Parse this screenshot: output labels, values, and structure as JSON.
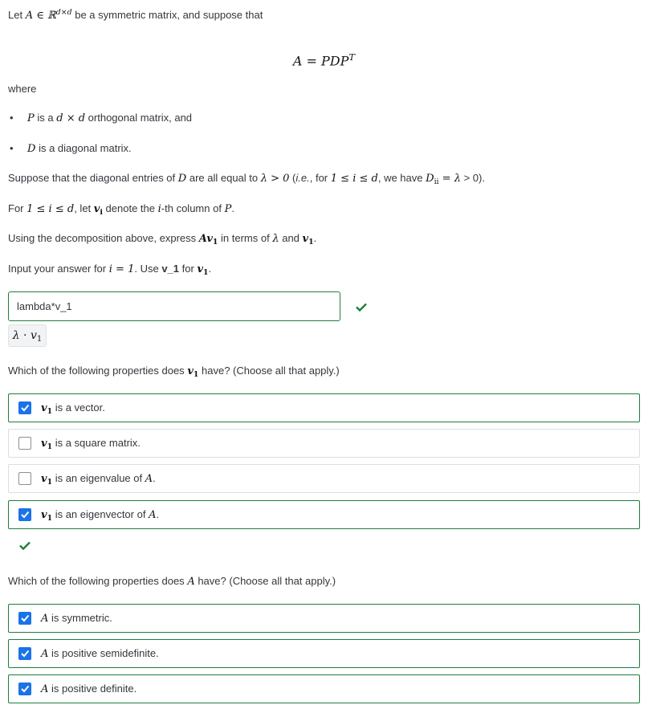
{
  "intro": {
    "prefix": "Let",
    "math_setA": "A ∈ ℝ",
    "math_setsup": "d×d",
    "suffix": "be a symmetric matrix, and suppose that"
  },
  "equation": {
    "lhs": "A = PDP",
    "sup": "T"
  },
  "where_label": "where",
  "bullets": [
    {
      "math": "P",
      "text_pre": "is a",
      "math2": "d × d",
      "text_post": "orthogonal matrix, and"
    },
    {
      "math": "D",
      "text_post": "is a diagonal matrix."
    }
  ],
  "suppose": {
    "t1": "Suppose that the diagonal entries of",
    "m1": "D",
    "t2": "are all equal to",
    "m2": "λ > 0",
    "t3": "(",
    "t3_italic": "i.e.",
    "t3b": ", for",
    "m3": "1 ≤ i ≤ d",
    "t4": ", we have",
    "m4": "D",
    "m4_sub": "ii",
    "m4_rest": " = λ",
    "t5": "> 0)."
  },
  "for_line": {
    "t1": "For",
    "m1": "1 ≤ i ≤ d",
    "t2": ", let",
    "m2": "v",
    "m2_sub": "i",
    "t3": "denote the",
    "m3": "i",
    "t4": "-th column of",
    "m4": "P",
    "t5": "."
  },
  "using_line": {
    "t1": "Using the decomposition above, express",
    "m1": "Av",
    "m1_sub": "1",
    "t2": "in terms of",
    "m2": "λ",
    "t3": "and",
    "m3": "v",
    "m3_sub": "1",
    "t4": "."
  },
  "input_line": {
    "t1": "Input your answer for",
    "m1": "i = 1",
    "t2": ". Use",
    "code": "v_1",
    "t3": "for",
    "m2": "v",
    "m2_sub": "1",
    "t4": "."
  },
  "answer": {
    "value": "lambda*v_1",
    "preview_lambda": "λ · v",
    "preview_sub": "1"
  },
  "q1": {
    "t1": "Which of the following properties does",
    "m1": "v",
    "m1_sub": "1",
    "t2": "have? (Choose all that apply.)",
    "options": [
      {
        "m": "v",
        "sub": "1",
        "text": "is a vector.",
        "checked": true
      },
      {
        "m": "v",
        "sub": "1",
        "text": "is a square matrix.",
        "checked": false
      },
      {
        "m": "v",
        "sub": "1",
        "text": "is an eigenvalue of",
        "m2": "A",
        "end": ".",
        "checked": false
      },
      {
        "m": "v",
        "sub": "1",
        "text": "is an eigenvector of",
        "m2": "A",
        "end": ".",
        "checked": true
      }
    ]
  },
  "q2": {
    "t1": "Which of the following properties does",
    "m1": "A",
    "t2": "have? (Choose all that apply.)",
    "options": [
      {
        "m": "A",
        "text": "is symmetric.",
        "checked": true
      },
      {
        "m": "A",
        "text": "is positive semidefinite.",
        "checked": true
      },
      {
        "m": "A",
        "text": "is positive definite.",
        "checked": true
      }
    ]
  },
  "colors": {
    "correct": "#1d7f3c",
    "checkbox": "#1a73e8"
  }
}
